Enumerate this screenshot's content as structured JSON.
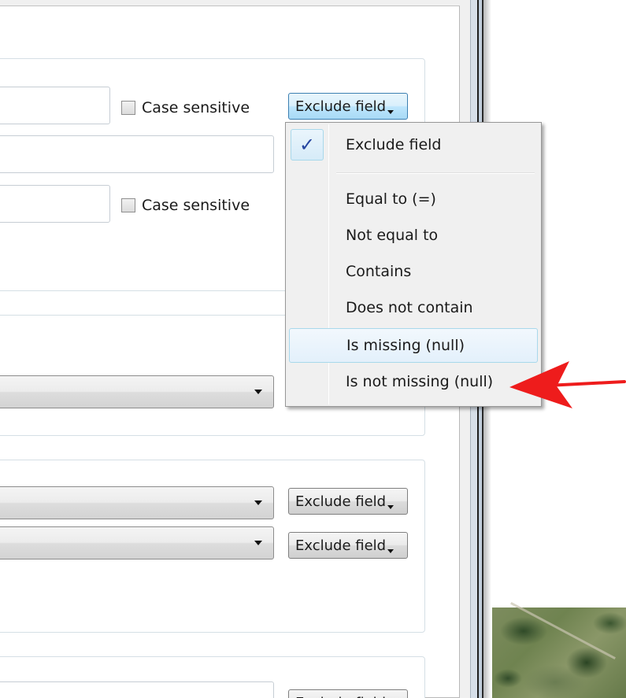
{
  "filters": {
    "case_sensitive_label": "Case sensitive",
    "exclude_button_label": "Exclude field"
  },
  "menu": {
    "items": [
      {
        "label": "Exclude field",
        "checked": true
      },
      {
        "label": "Equal to (=)"
      },
      {
        "label": "Not equal to"
      },
      {
        "label": "Contains"
      },
      {
        "label": "Does not contain"
      },
      {
        "label": "Is missing (null)",
        "hovered": true
      },
      {
        "label": "Is not missing (null)"
      }
    ],
    "check_glyph": "✓"
  },
  "colors": {
    "annotation_arrow": "#ee1c1c",
    "menu_hover": "#e3f0fb",
    "check_mark": "#2545a0"
  },
  "icons": [
    "checkmark-icon",
    "chevron-down-icon",
    "arrow-annotation-icon"
  ]
}
